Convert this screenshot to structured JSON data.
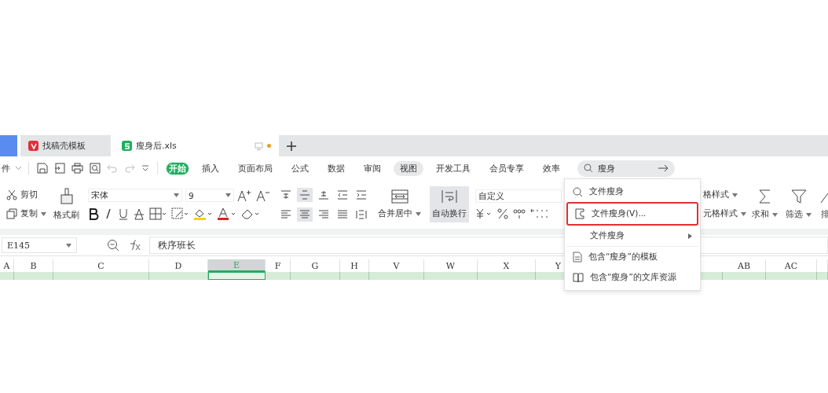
{
  "doc_tabs": [
    {
      "label": "找稿壳模板",
      "selected": false
    },
    {
      "label": "瘦身后.xls",
      "selected": true
    }
  ],
  "file_menu": "件",
  "menu_tabs": [
    {
      "label": "开始",
      "selected": true,
      "hovered": false
    },
    {
      "label": "插入",
      "selected": false,
      "hovered": false
    },
    {
      "label": "页面布局",
      "selected": false,
      "hovered": false
    },
    {
      "label": "公式",
      "selected": false,
      "hovered": false
    },
    {
      "label": "数据",
      "selected": false,
      "hovered": false
    },
    {
      "label": "审阅",
      "selected": false,
      "hovered": false
    },
    {
      "label": "视图",
      "selected": false,
      "hovered": true
    },
    {
      "label": "开发工具",
      "selected": false,
      "hovered": false
    },
    {
      "label": "会员专享",
      "selected": false,
      "hovered": false
    },
    {
      "label": "效率",
      "selected": false,
      "hovered": false
    }
  ],
  "search": {
    "value": "瘦身"
  },
  "clipboard": {
    "cut": "剪切",
    "copy": "复制",
    "painter": "格式刷"
  },
  "font": {
    "name": "宋体",
    "size": "9"
  },
  "align_top": [
    {
      "on": false
    },
    {
      "on": true
    },
    {
      "on": false
    }
  ],
  "align_bottom": [
    {
      "on": false
    },
    {
      "on": true
    },
    {
      "on": false
    }
  ],
  "merge": "合并居中",
  "wrap": {
    "label": "自动换行",
    "on": true
  },
  "number_format": "自定义",
  "styles": [
    "格样式",
    "元格样式"
  ],
  "tools": [
    "求和",
    "筛选",
    "排"
  ],
  "cell_ref": "E145",
  "formula": "秩序班长",
  "columns": [
    {
      "label": "A",
      "selected": false
    },
    {
      "label": "B",
      "selected": false
    },
    {
      "label": "C",
      "selected": false
    },
    {
      "label": "D",
      "selected": false
    },
    {
      "label": "E",
      "selected": true
    },
    {
      "label": "F",
      "selected": false
    },
    {
      "label": "G",
      "selected": false
    },
    {
      "label": "H",
      "selected": false
    },
    {
      "label": "V",
      "selected": false
    },
    {
      "label": "W",
      "selected": false
    },
    {
      "label": "X",
      "selected": false
    },
    {
      "label": "Y",
      "selected": false
    },
    {
      "label": "AB",
      "selected": false
    },
    {
      "label": "AC",
      "selected": false
    }
  ],
  "dropdown": [
    {
      "kind": "search",
      "label": "文件瘦身",
      "highlighted": false
    },
    {
      "kind": "command",
      "label": "文件瘦身(V)...",
      "highlighted": true
    },
    {
      "kind": "submenu",
      "label": "文件瘦身",
      "highlighted": false
    },
    {
      "kind": "template",
      "label": "包含“瘦身”的模板",
      "highlighted": false
    },
    {
      "kind": "library",
      "label": "包含“瘦身”的文库资源",
      "highlighted": false
    }
  ]
}
